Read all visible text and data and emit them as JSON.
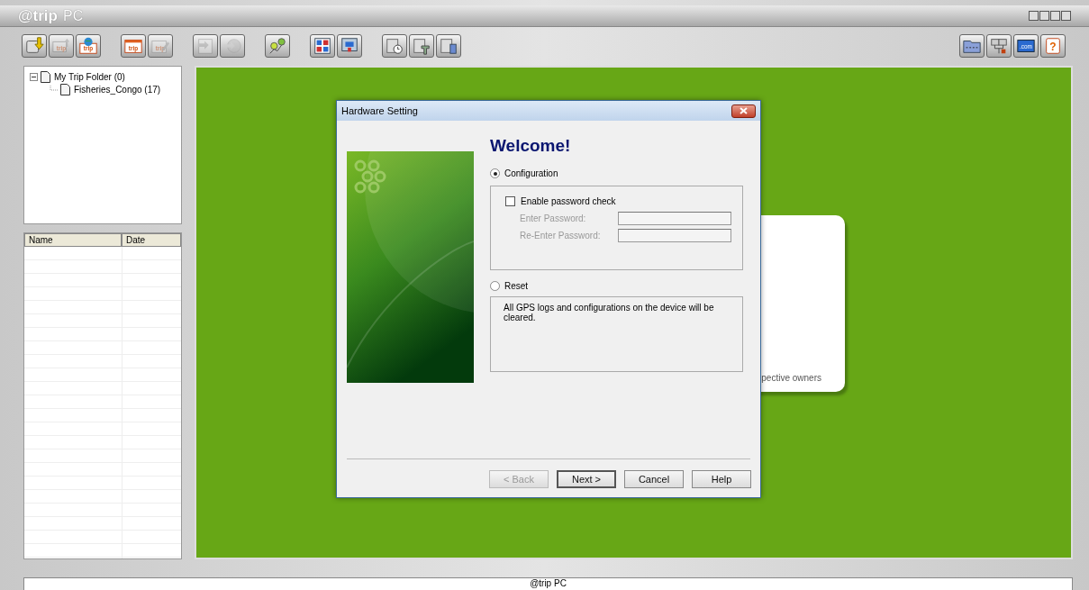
{
  "window": {
    "title_brand": "@trip",
    "title_rest": "PC"
  },
  "toolbar_left": [
    {
      "kind": "import",
      "disabled": false
    },
    {
      "kind": "upload",
      "label": "trip",
      "disabled": true
    },
    {
      "kind": "globe",
      "label": "trip",
      "disabled": false
    },
    {
      "kind": "trip",
      "label": "trip",
      "disabled": false
    },
    {
      "kind": "edit",
      "label": "trip",
      "disabled": true
    },
    {
      "kind": "convert",
      "disabled": true
    },
    {
      "kind": "arrow",
      "disabled": true
    },
    {
      "kind": "pins",
      "disabled": false
    },
    {
      "kind": "grid",
      "disabled": false
    },
    {
      "kind": "screen",
      "disabled": false
    },
    {
      "kind": "clock",
      "disabled": false
    },
    {
      "kind": "tool",
      "disabled": false
    },
    {
      "kind": "trash",
      "disabled": false
    }
  ],
  "toolbar_right": [
    {
      "kind": "folder"
    },
    {
      "kind": "network"
    },
    {
      "kind": "web",
      "label": ".com"
    },
    {
      "kind": "help",
      "label": "?"
    }
  ],
  "tree": [
    {
      "label": "My Trip Folder (0)",
      "expanded": true,
      "selected": false,
      "children": [
        {
          "label": "Fisheries_Congo (17)",
          "selected": false
        }
      ]
    }
  ],
  "file_list": {
    "columns": [
      "Name",
      "Date"
    ]
  },
  "background_card": {
    "text": "pective owners"
  },
  "dialog": {
    "title": "Hardware Setting",
    "heading": "Welcome!",
    "options": [
      {
        "label": "Configuration",
        "selected": true
      },
      {
        "label": "Reset",
        "selected": false
      }
    ],
    "password_check": {
      "label": "Enable password check",
      "checked": false
    },
    "password_fields": [
      {
        "label": "Enter Password:",
        "disabled": true
      },
      {
        "label": "Re-Enter Password:",
        "disabled": true
      }
    ],
    "reset_note": "All GPS logs and configurations on the device will be cleared.",
    "buttons": [
      {
        "label": "< Back",
        "disabled": true,
        "default": false
      },
      {
        "label": "Next >",
        "disabled": false,
        "default": true
      },
      {
        "label": "Cancel",
        "disabled": false,
        "default": false
      },
      {
        "label": "Help",
        "disabled": false,
        "default": false
      }
    ]
  },
  "status_bar": {
    "text": "@trip PC"
  }
}
